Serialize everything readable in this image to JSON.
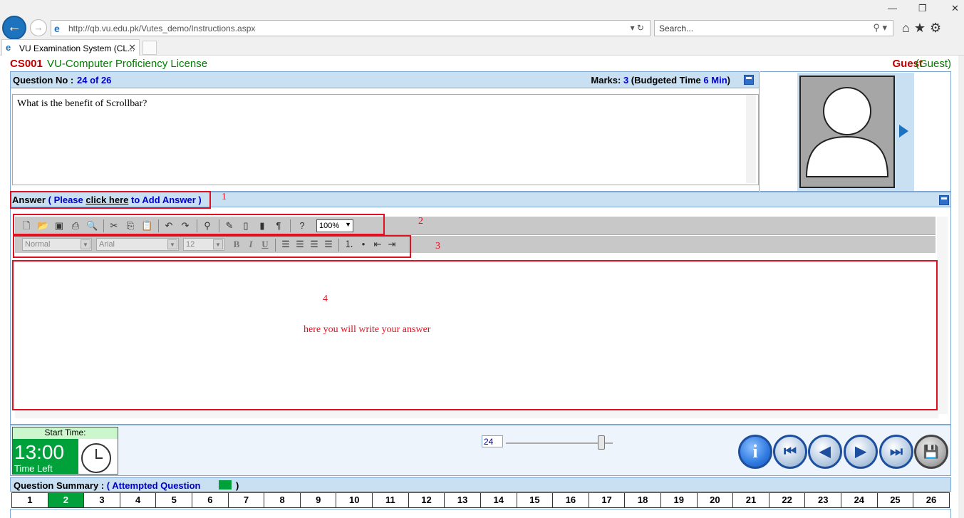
{
  "browser": {
    "url": "http://qb.vu.edu.pk/Vutes_demo/Instructions.aspx",
    "search_placeholder": "Search...",
    "tab_title": "VU Examination System (CL...",
    "tab_close": "✕",
    "back": "←",
    "forward": "→",
    "addr_controls": "▾ ↻",
    "search_controls": "⚲ ▾",
    "toolbar_icons": "⌂★⚙",
    "minimize": "—",
    "restore": "❐",
    "close": "✕"
  },
  "header": {
    "course_code": "CS001",
    "course_name": "VU-Computer Proficiency License",
    "user": "Guest",
    "user_role": "(Guest)"
  },
  "question": {
    "label": "Question No :",
    "number": "24 of 26",
    "marks_label": "Marks:",
    "marks": "3",
    "budget_open": "(Budgeted Time",
    "budget_time": "6 Min",
    "budget_close": ")",
    "text": "What is the benefit of Scrollbar?"
  },
  "answer": {
    "label": "Answer",
    "paren_open": "(",
    "please": "Please",
    "link": "click here",
    "to_add": "to Add Answer",
    "paren_close": ")",
    "placeholder_note": "here you will write your answer"
  },
  "annotations": {
    "one": "1",
    "two": "2",
    "three": "3",
    "four": "4"
  },
  "editor": {
    "zoom": "100%",
    "style": "Normal",
    "font": "Arial",
    "size": "12",
    "bold": "B",
    "italic": "I",
    "underline": "U"
  },
  "timer": {
    "start_label": "Start Time:",
    "time": "13:00",
    "time_left": "Time Left"
  },
  "navigation": {
    "current": "24",
    "info": "i",
    "first": "⏮",
    "prev": "◀",
    "next": "▶",
    "last": "⏭",
    "save": "💾"
  },
  "summary": {
    "label": "Question Summary :",
    "paren_open": "(",
    "attempted": "Attempted Question",
    "paren_close": ")",
    "attempted_color": "#00a13a",
    "questions": [
      "1",
      "2",
      "3",
      "4",
      "5",
      "6",
      "7",
      "8",
      "9",
      "10",
      "11",
      "12",
      "13",
      "14",
      "15",
      "16",
      "17",
      "18",
      "19",
      "20",
      "21",
      "22",
      "23",
      "24",
      "25",
      "26"
    ],
    "attempted_list": [
      "2"
    ]
  }
}
